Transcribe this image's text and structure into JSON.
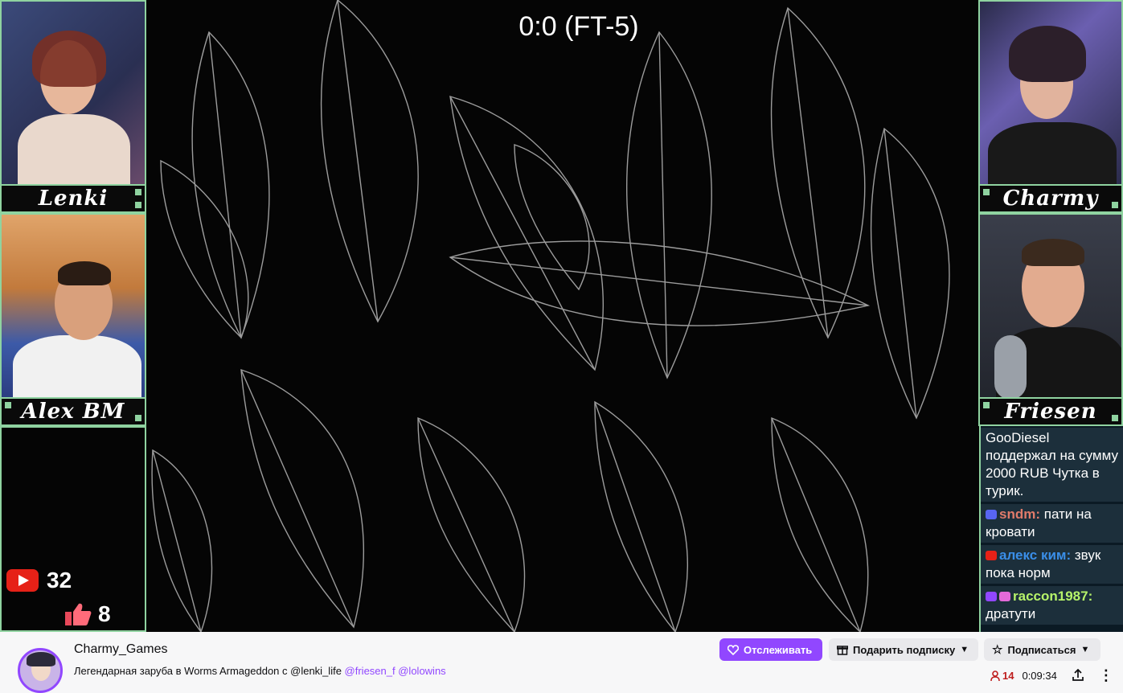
{
  "stream": {
    "score": "0:0 (FT-5)",
    "cams": [
      {
        "name": "Lenki"
      },
      {
        "name": "Alex BM"
      },
      {
        "name": "Charmy"
      },
      {
        "name": "Friesen"
      }
    ],
    "counters": {
      "youtube_count": "32",
      "likes_count": "8"
    },
    "chat": [
      {
        "user": "GooDiesel",
        "text": "поддержал на сумму 2000 RUB Чутка в турик.",
        "user_color": "#ffffff",
        "badge": ""
      },
      {
        "user": "sndm:",
        "text": "пати на кровати",
        "user_color": "#e07b6a",
        "badge": "discord"
      },
      {
        "user": "алекс ким:",
        "text": "звук пока норм",
        "user_color": "#3a8ee8",
        "badge": "youtube"
      },
      {
        "user": "raccon1987:",
        "text": "дратути",
        "user_color": "#b6f36a",
        "badge": "twitch"
      }
    ]
  },
  "channel": {
    "name": "Charmy_Games",
    "title_prefix": "Легендарная заруба в Worms Armageddon с @lenki_life",
    "tag1": "@friesen_f",
    "tag2": "@lolowins"
  },
  "actions": {
    "follow_label": "Отслеживать",
    "gift_label": "Подарить подписку",
    "subscribe_label": "Подписаться"
  },
  "meta": {
    "viewers": "14",
    "uptime": "0:09:34"
  },
  "colors": {
    "accent": "#9147ff",
    "frame": "#8fd3a0",
    "live_red": "#be1e1e"
  }
}
